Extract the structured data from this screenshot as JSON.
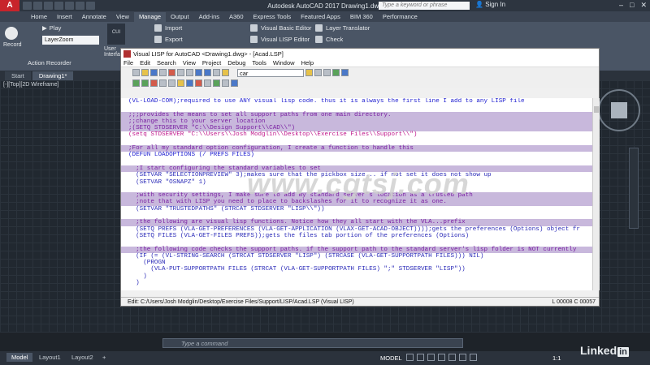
{
  "app": {
    "title": "Autodesk AutoCAD 2017    Drawing1.dwg",
    "logo": "A",
    "search_placeholder": "Type a keyword or phrase",
    "signin": "Sign In",
    "window_controls": [
      "–",
      "□",
      "✕"
    ]
  },
  "ribbon_tabs": [
    "Home",
    "Insert",
    "Annotate",
    "View",
    "Manage",
    "Output",
    "Add-ins",
    "A360",
    "Express Tools",
    "Featured Apps",
    "BIM 360",
    "Performance"
  ],
  "ribbon_active_tab": "Manage",
  "ribbon": {
    "record": "Record",
    "play": "Play",
    "layer_dropdown": "LayerZoom",
    "user": "User\nInterfa",
    "import": "Import",
    "export": "Export",
    "visual_basic": "Visual Basic Editor",
    "visual_lisp": "Visual LISP Editor",
    "layer_translator": "Layer Translator",
    "check": "Check",
    "action_recorder": "Action Recorder"
  },
  "doc_tabs": [
    "Start",
    "Drawing1*"
  ],
  "viewport_label": "[-][Top][2D Wireframe]",
  "vlisp": {
    "title": "Visual LISP for AutoCAD <Drawing1.dwg> - [Acad.LSP]",
    "menu": [
      "File",
      "Edit",
      "Search",
      "View",
      "Project",
      "Debug",
      "Tools",
      "Window",
      "Help"
    ],
    "search_value": "car",
    "status_path": "Edit:  C:/Users/Josh Modglin/Desktop/Exercise Files/Support/LISP/Acad.LSP   (Visual LISP)",
    "status_pos": "L 00008  C 00057",
    "lines": [
      {
        "t": "(VL-LOAD-COM);required to use ANY visual lisp code. thus it is always the first line I add to any LISP file",
        "c": "kw"
      },
      {
        "t": "",
        "c": "df"
      },
      {
        "t": ";;;provides the means to set all support paths from one main directory.",
        "c": "cm hl"
      },
      {
        "t": ";;change this to your server location",
        "c": "cm hl"
      },
      {
        "t": ";(SETQ STDSERVER \"C:\\\\Design Support\\\\CAD\\\\\")",
        "c": "cm hl"
      },
      {
        "t": "(setq STDSERVER \"C:\\\\Users\\\\Josh Modglin\\\\Desktop\\\\Exercise Files\\\\Support\\\\\")",
        "c": "st"
      },
      {
        "t": "",
        "c": "df"
      },
      {
        "t": ";For all my standard option configuration, I create a function to handle this",
        "c": "cm hl"
      },
      {
        "t": "(DEFUN LOADOPTIONS (/ PREFS FILES)",
        "c": "kw"
      },
      {
        "t": "",
        "c": "df"
      },
      {
        "t": "  ;I start configuring the standard variables to set",
        "c": "cm hl"
      },
      {
        "t": "  (SETVAR \"SELECTIONPREVIEW\" 3);makes sure that the pickbox size... if not set it does not show up",
        "c": "fn"
      },
      {
        "t": "  (SETVAR \"OSNAPZ\" 1)",
        "c": "fn"
      },
      {
        "t": "",
        "c": "df"
      },
      {
        "t": "  ;with security settings, I make sure to add my standard server's location as a trusted path",
        "c": "cm hl"
      },
      {
        "t": "  ;note that with LISP you need to place to backslashes for it to recognize it as one.",
        "c": "cm hl"
      },
      {
        "t": "  (SETVAR \"TRUSTEDPATHS\" (STRCAT STDSERVER \"LISP\\\\\"))",
        "c": "fn"
      },
      {
        "t": "",
        "c": "df"
      },
      {
        "t": "  ;the following are visual lisp functions. Notice how they all start with the VLA...prefix",
        "c": "cm hl"
      },
      {
        "t": "  (SETQ PREFS (VLA-GET-PREFERENCES (VLA-GET-APPLICATION (VLAX-GET-ACAD-OBJECT))));gets the preferences (Options) object fr",
        "c": "fn"
      },
      {
        "t": "  (SETQ FILES (VLA-GET-FILES PREFS));gets the files tab portion of the preferences (Options)",
        "c": "fn"
      },
      {
        "t": "",
        "c": "df"
      },
      {
        "t": "  ;the following code checks the support paths. if the support path to the standard server's lisp folder is NOT currently",
        "c": "cm hl"
      },
      {
        "t": "  (IF (= (VL-STRING-SEARCH (STRCAT STDSERVER \"LISP\") (STRCASE (VLA-GET-SUPPORTPATH FILES))) NIL)",
        "c": "fn"
      },
      {
        "t": "    (PROGN",
        "c": "fn"
      },
      {
        "t": "      (VLA-PUT-SUPPORTPATH FILES (STRCAT (VLA-GET-SUPPORTPATH FILES) \";\" STDSERVER \"LISP\"))",
        "c": "fn"
      },
      {
        "t": "    )",
        "c": "fn"
      },
      {
        "t": "  )",
        "c": "fn"
      }
    ]
  },
  "command_line_placeholder": "Type a command",
  "layout_tabs": [
    "Model",
    "Layout1",
    "Layout2",
    "+"
  ],
  "status_bar": {
    "model": "MODEL",
    "scale": "1:1"
  },
  "watermark": "www.cgtsj.com",
  "brand": {
    "linked": "Linked",
    "in": "in"
  }
}
